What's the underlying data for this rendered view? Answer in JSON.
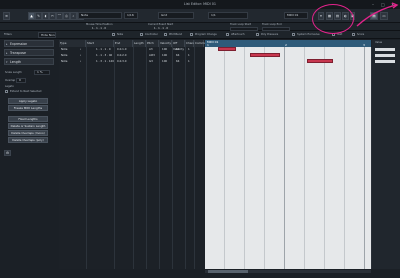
{
  "window": {
    "title": "List Editor: MIDI 01",
    "min": "–",
    "max": "□",
    "close": "✕"
  },
  "toolbar": {
    "tools": [
      "▲",
      "✎",
      "◖",
      "✂",
      "⌒",
      "◎",
      "⌕",
      "♪",
      "✋"
    ],
    "insert_type": "Note",
    "quantize": "1/16",
    "quantize_mode": "Grid",
    "length": "1/1",
    "track": "MIDI 01",
    "view_icons": [
      "▦",
      "▤",
      "◐",
      "▣"
    ],
    "window_controls": [
      "▤",
      "▭"
    ]
  },
  "infoline": {
    "labels": [
      "Mouse Time Position",
      "Current Event Start",
      "Track Loop Start",
      "Track Loop End"
    ],
    "values": [
      "1 . 1 . 1 . 0",
      "1 . 1 . 1 . 0"
    ],
    "checks": [
      "Note",
      "Controller",
      "PitchBend",
      "Program Change",
      "Aftertouch",
      "Poly Pressure",
      "System Exclusive",
      "Text",
      "Score"
    ]
  },
  "filterbar": {
    "label": "Filters",
    "field": "Hide None"
  },
  "inspector": {
    "sections": [
      "Expression",
      "Transpose",
      "Length"
    ],
    "length_label": "Scale Length",
    "length_value": "1 %",
    "overlap_label": "Overlap",
    "overlap_value": "0",
    "legato_label": "Legato",
    "extend_label": "Extend to Next Selected",
    "buttons": [
      "Apply Legato",
      "Freeze MIDI Lengths",
      "Fixed Lengths",
      "Delete or Sustain Length",
      "Delete Overlaps (mono)",
      "Delete Overlaps (poly)"
    ]
  },
  "list": {
    "headers": [
      "Type",
      "Start",
      "End",
      "Length",
      "Pitch",
      "Velocity",
      "Off Velocity",
      "Channel",
      "Comment"
    ],
    "rows": [
      {
        "type": "Note",
        "icon": "♩",
        "start": "1 . 1 . 1 . 0",
        "end": "1 . 2 . 1 . 0",
        "length": "0.0.1.0",
        "pitch": "A3",
        "velocity": "100",
        "offvel": "64",
        "channel": "1"
      },
      {
        "type": "Note",
        "icon": "♩",
        "start": "1 . 1 . 3 . 40",
        "end": "1 . 2 . 4 . 0",
        "length": "0.0.2.0",
        "pitch": "A#3",
        "velocity": "100",
        "offvel": "64",
        "channel": "1"
      },
      {
        "type": "Note",
        "icon": "♩",
        "start": "1 . 3 . 1 . 120",
        "end": "1 . 3 . 4 . 0",
        "length": "0.0.3.0",
        "pitch": "G3",
        "velocity": "100",
        "offvel": "64",
        "channel": "1"
      }
    ]
  },
  "grid": {
    "part_label": "MIDI 01",
    "bars": [
      "1",
      "2",
      "3"
    ],
    "colors": {
      "event": "#c7374f",
      "ruler": "#2f5b7a",
      "highlight": "#e2238b"
    }
  },
  "rightpane": {
    "header": "Value"
  }
}
